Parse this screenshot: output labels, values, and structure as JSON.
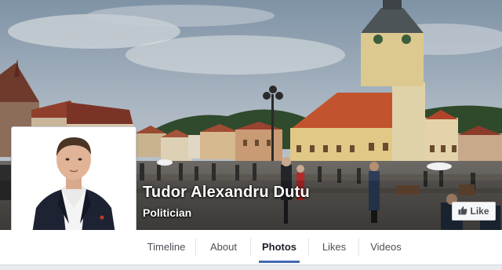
{
  "page": {
    "name": "Tudor Alexandru Dutu",
    "category": "Politician"
  },
  "actions": {
    "like_label": "Like",
    "like_icon": "thumbs-up-icon"
  },
  "tabs": [
    {
      "label": "Timeline",
      "active": false
    },
    {
      "label": "About",
      "active": false
    },
    {
      "label": "Photos",
      "active": true
    },
    {
      "label": "Likes",
      "active": false
    },
    {
      "label": "Videos",
      "active": false
    }
  ],
  "colors": {
    "accent": "#4267b2",
    "tab_bar": "#ffffff",
    "background": "#e9ebee"
  }
}
